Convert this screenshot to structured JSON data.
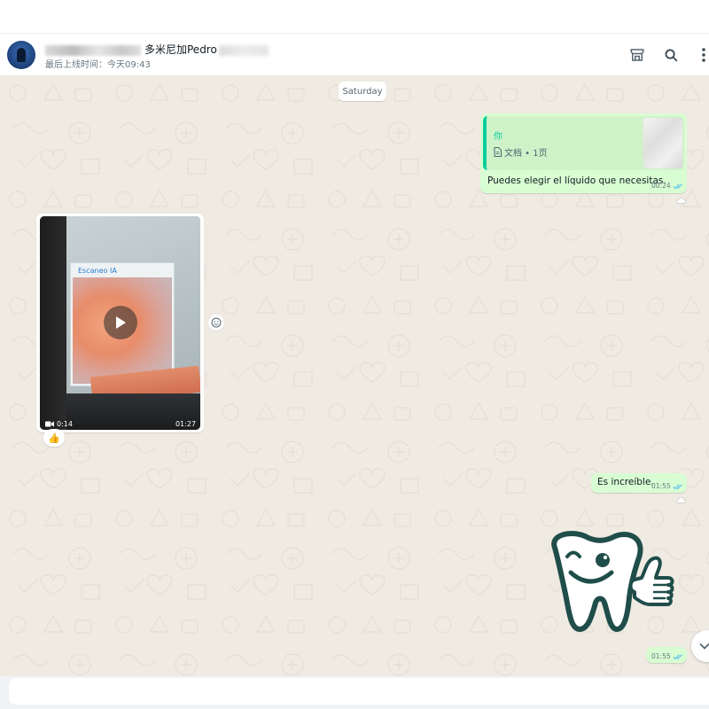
{
  "header": {
    "contact_name_visible": "多米尼加Pedro",
    "last_seen": "最后上线时间：今天09:43",
    "icons": [
      "store-icon",
      "search-icon",
      "menu-icon"
    ]
  },
  "chat": {
    "date_chip": "Saturday",
    "messages": [
      {
        "direction": "outgoing",
        "quote_author": "你",
        "quote_doc": "文档 • 1页",
        "text": "Puedes elegir el líquido que necesitas.",
        "time": "00:24",
        "status": "read"
      },
      {
        "direction": "incoming",
        "type": "video",
        "duration": "0:14",
        "time": "01:27",
        "frame_label": "Escaneo IA",
        "reaction": "👍"
      },
      {
        "direction": "outgoing",
        "text": "Es increíble.",
        "time": "01:55",
        "status": "read"
      },
      {
        "direction": "outgoing",
        "type": "sticker",
        "sticker": "tooth-thumbs-up",
        "time": "01:55",
        "status": "read"
      }
    ]
  },
  "colors": {
    "outgoing_bubble": "#d9fdd3",
    "incoming_bubble": "#ffffff",
    "chat_background": "#efeae2",
    "accent": "#06cf9c",
    "read_ticks": "#53bdeb",
    "sticker_teal": "#1f4d4a"
  }
}
